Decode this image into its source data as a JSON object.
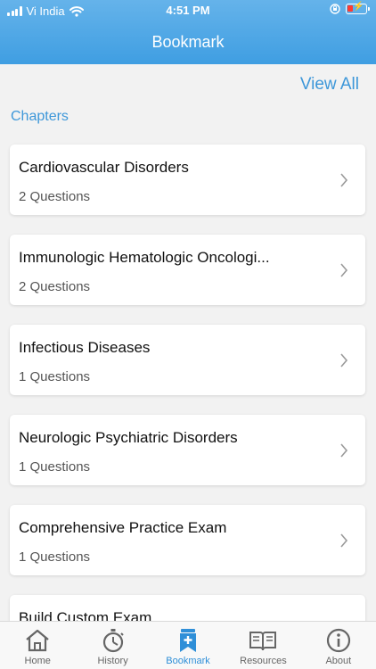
{
  "status_bar": {
    "carrier": "Vi India",
    "time": "4:51 PM"
  },
  "header": {
    "title": "Bookmark"
  },
  "main": {
    "view_all": "View All",
    "section_label": "Chapters",
    "chapters": [
      {
        "title": "Cardiovascular Disorders",
        "count": "2 Questions"
      },
      {
        "title": "Immunologic Hematologic Oncologi...",
        "count": "2 Questions"
      },
      {
        "title": "Infectious Diseases",
        "count": "1 Questions"
      },
      {
        "title": "Neurologic Psychiatric Disorders",
        "count": "1 Questions"
      },
      {
        "title": "Comprehensive Practice Exam",
        "count": "1 Questions"
      },
      {
        "title": "Build Custom Exam",
        "count": ""
      }
    ]
  },
  "tabbar": {
    "items": [
      {
        "label": "Home",
        "icon": "home-icon"
      },
      {
        "label": "History",
        "icon": "stopwatch-icon"
      },
      {
        "label": "Bookmark",
        "icon": "bookmark-icon",
        "active": true
      },
      {
        "label": "Resources",
        "icon": "book-icon"
      },
      {
        "label": "About",
        "icon": "info-icon"
      }
    ]
  },
  "colors": {
    "accent": "#3d97d9",
    "header": "#4aa6e6",
    "battery_low": "#ff3b30"
  }
}
